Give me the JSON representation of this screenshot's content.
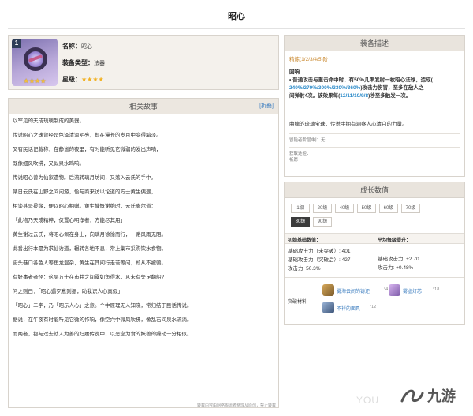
{
  "page": {
    "title": "昭心"
  },
  "weapon": {
    "rank": "1",
    "stars_icon": "★★★★",
    "name_key": "名称：",
    "name_val": "昭心",
    "type_key": "装备类型：",
    "type_val": "法器",
    "star_key": "星级：",
    "star_val": "★★★★",
    "star_color": "#f2b01e"
  },
  "story": {
    "title": "相关故事",
    "fold": "[折叠]",
    "lines": [
      "以罕见的天成琉璃制成的美器。",
      "传说昭心之珠曾经是色泽清润明亮，却在漫长的岁月中变得黯淡。",
      "又有民话记载称，在静谧的夜里，有时能听见它微弱的发出声响，",
      "既像细风吹拂，又似泉水鸣响。",
      "传说昭心曾为仙家遗物。后流转璃月坊间，又落入云氏的手中。",
      "某日云氏在山野之间闲游，恰与商来访以论道的方士黄生偶遇，",
      "相谈甚是投缘，便以昭心相赠。黄生慷慨谢绝时，云氏离尔道：",
      "「此物乃天成精粹，仅置心明净者，方能尽其用」",
      "黄生谢过云氏，将昭心佩在身上，向璃月徐徐而行，一路风雨无阻。",
      "此番出行本是为求仙访道，辗转各地不息，常上集市采购饮水食物。",
      "街头巷口各色人等鱼龙混杂，黄生在其间行走若等闲，却从不被骗。",
      "有好事者者怪：这昊方士在市井之间露如鱼得水，从未有失足翻船?",
      "问之则曰：「昭心遇歹意则振，助我识人心真假」",
      "「昭心」二字，乃「昭示人心」之意。个中原理无人知晓，常归结于民话传说。",
      "据说，在午夜有时能听见它微的作响，像空穴中微风吹拂，像乱石间泉水流淌。",
      "而两者，都与过去幼人为善的妇履传说中，以恶念为食的妖兽的躁动十分相似。"
    ]
  },
  "equip": {
    "title": "装备描述",
    "refine": "精炼(1/2/3/4/5)阶",
    "effect_name": "回响",
    "line1": "• 普通攻击与重击命中时，有50%几率发射一枚昭心法球，造成(",
    "line2_hl": "240%/270%/300%/330%/360%",
    "line2_rest": ")攻击力伤害，至多在敌人之",
    "line3_a": "间弹射4次。该效果每(",
    "line3_hl": "12/11/10/9/8",
    "line3_b": ")秒至多触发一次。",
    "quote": "曲螭的琉璃宝珠，传说中拥有洞察人心清白的力量。",
    "source_label": "冒险者阶层/制：无",
    "obtain_label": "获取途径：",
    "obtain_value": "祈愿"
  },
  "growth": {
    "title": "成长数值",
    "levels": [
      "1级",
      "20级",
      "40级",
      "50级",
      "60级",
      "70级",
      "80级",
      "90级"
    ],
    "active_level": "80级",
    "base_header": "初始基础数值：",
    "avg_header": "平均每级提升：",
    "base_lines": [
      "基础攻击力（未突破）: 401",
      "基础攻击力（突破后）: 427",
      "攻击力: 50.3%"
    ],
    "avg_lines": [
      "基础攻击力: +2.70",
      "攻击力: +0.48%"
    ],
    "mat_label": "突破材料",
    "materials": [
      {
        "name": "雾海云间的铸还",
        "count": "*4"
      },
      {
        "name": "雾虚灯芯",
        "count": "*18"
      },
      {
        "name": "不祥的面具",
        "count": "*12"
      }
    ]
  },
  "footer": {
    "text": "转载内容由网络搬运者整理及原创，禁止转载"
  },
  "watermark": {
    "you": "YOU",
    "logo_text": "九游"
  }
}
